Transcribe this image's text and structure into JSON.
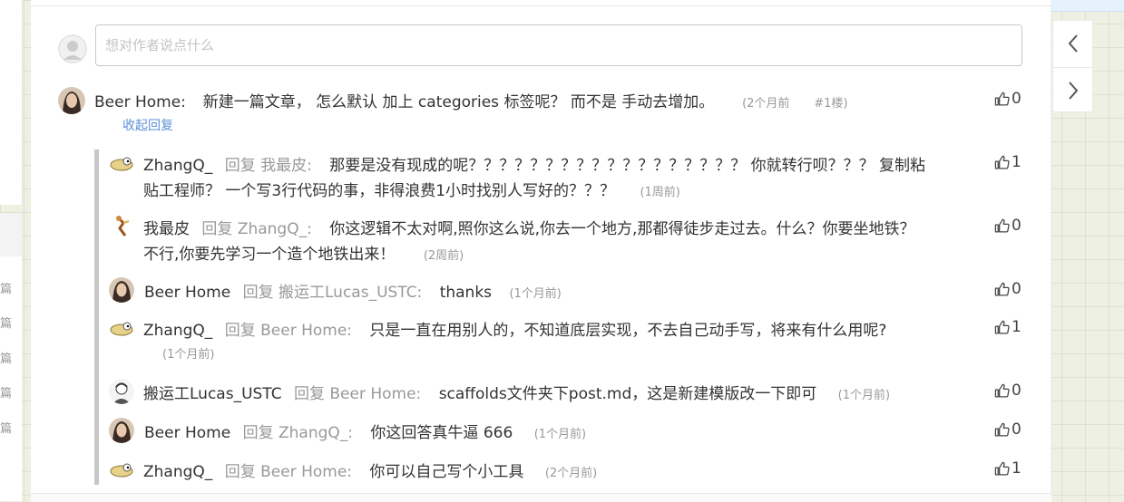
{
  "input": {
    "placeholder": "想对作者说点什么"
  },
  "main_comment": {
    "user": "Beer Home:",
    "body": "新建一篇文章， 怎么默认 加上 categories 标签呢？ 而不是 手动去增加。",
    "time": "(2个月前",
    "floor": "#1楼)",
    "likes": "0",
    "collapse_label": "收起回复"
  },
  "replies": [
    {
      "user": "ZhangQ_",
      "reply_label": "回复",
      "target": "我最皮:",
      "body_line1": "那要是没有现成的呢？？？？？？？？？？？？？？？？？？ 你就转行呗？？？ 复制粘",
      "body_line2": "贴工程师？ 一个写3行代码的事，非得浪费1小时找别人写好的？？？",
      "time": "(1周前)",
      "likes": "1",
      "avatar": "gull"
    },
    {
      "user": "我最皮",
      "reply_label": "回复",
      "target": "ZhangQ_:",
      "body_line1": "你这逻辑不太对啊,照你这么说,你去一个地方,那都得徒步走过去。什么？你要坐地铁？",
      "body_line2": "不行,你要先学习一个造个地铁出来！",
      "time": "(2周前)",
      "likes": "0",
      "avatar": "figure"
    },
    {
      "user": "Beer Home",
      "reply_label": "回复",
      "target": "搬运工Lucas_USTC:",
      "body_line1": "thanks",
      "time": "(1个月前)",
      "likes": "0",
      "avatar": "woman"
    },
    {
      "user": "ZhangQ_",
      "reply_label": "回复",
      "target": "Beer Home:",
      "body_line1": "只是一直在用别人的，不知道底层实现，不去自己动手写，将来有什么用呢?",
      "time": "(1个月前)",
      "likes": "1",
      "avatar": "gull"
    },
    {
      "user": "搬运工Lucas_USTC",
      "reply_label": "回复",
      "target": "Beer Home:",
      "body_line1": "scaffolds文件夹下post.md，这是新建模版改一下即可",
      "time": "(1个月前)",
      "likes": "0",
      "avatar": "sketch"
    },
    {
      "user": "Beer Home",
      "reply_label": "回复",
      "target": "ZhangQ_:",
      "body_line1": "你这回答真牛逼 666",
      "time": "(1个月前)",
      "likes": "0",
      "avatar": "woman"
    },
    {
      "user": "ZhangQ_",
      "reply_label": "回复",
      "target": "Beer Home:",
      "body_line1": "你可以自己写个小工具",
      "time": "(2个月前)",
      "likes": "1",
      "avatar": "gull"
    }
  ],
  "left_glyphs": [
    "篇",
    "篇",
    "篇",
    "篇",
    "篇"
  ],
  "icons": {
    "like": "thumbs-up-icon",
    "prev": "chevron-left-icon",
    "next": "chevron-right-icon"
  }
}
